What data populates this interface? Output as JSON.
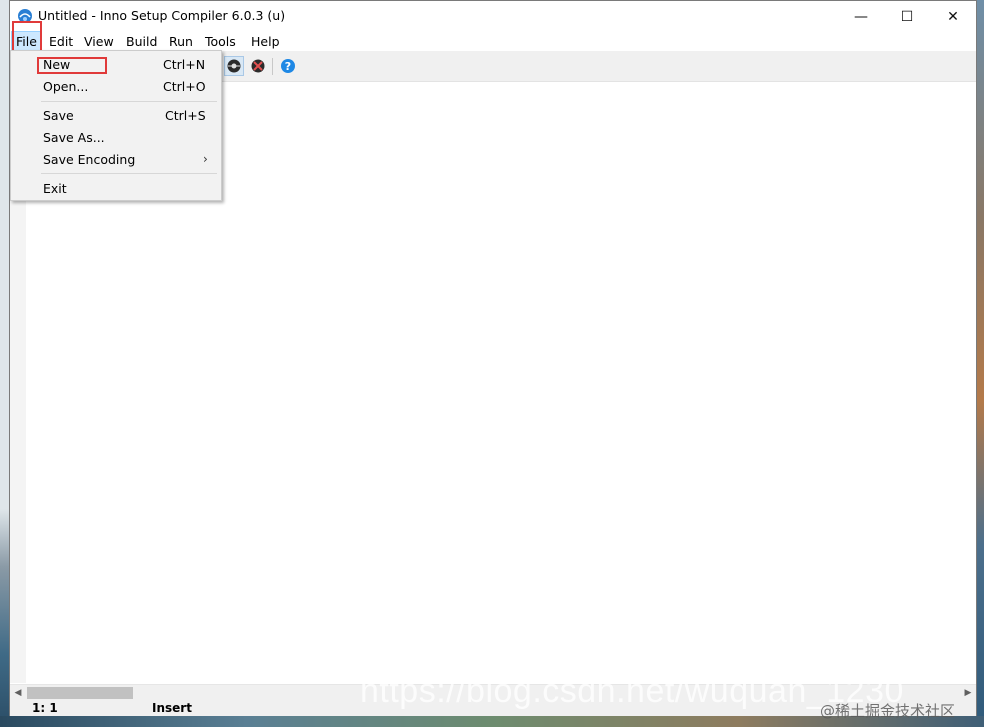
{
  "window": {
    "title": "Untitled - Inno Setup Compiler 6.0.3 (u)",
    "icon": "inno-setup-app-icon",
    "controls": {
      "minimize": "—",
      "maximize": "☐",
      "close": "✕"
    }
  },
  "menubar": {
    "items": [
      {
        "label": "File",
        "active": true
      },
      {
        "label": "Edit"
      },
      {
        "label": "View"
      },
      {
        "label": "Build"
      },
      {
        "label": "Run"
      },
      {
        "label": "Tools"
      },
      {
        "label": "Help"
      }
    ]
  },
  "file_menu": {
    "items": [
      {
        "label": "New",
        "shortcut": "Ctrl+N",
        "highlighted": true
      },
      {
        "label": "Open...",
        "shortcut": "Ctrl+O"
      },
      {
        "label": "Save",
        "shortcut": "Ctrl+S"
      },
      {
        "label": "Save As...",
        "shortcut": ""
      },
      {
        "label": "Save Encoding",
        "shortcut": "",
        "submenu": "›"
      },
      {
        "label": "Exit",
        "shortcut": ""
      }
    ]
  },
  "toolbar": {
    "icons": [
      "compile-run-icon",
      "stop-icon",
      "help-icon"
    ]
  },
  "statusbar": {
    "position": "1:   1",
    "mode": "Insert"
  },
  "annotation_color": "#e03a3a",
  "watermark": {
    "url": "https://blog.csdn.net/wuquan_1230",
    "site": "@稀土掘金技术社区"
  }
}
